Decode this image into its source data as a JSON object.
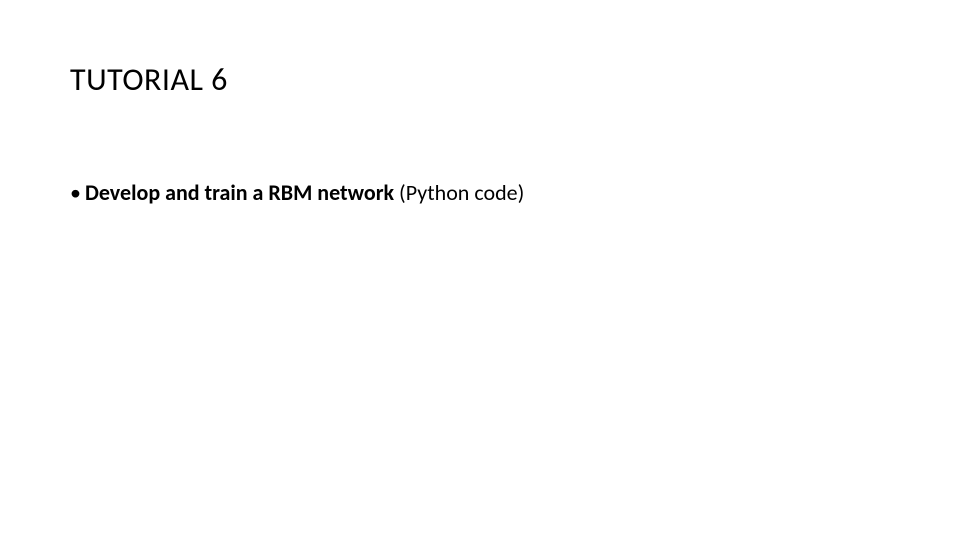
{
  "slide": {
    "title": "TUTORIAL 6",
    "bullet": {
      "mark": "•",
      "bold_part": "Develop and train a RBM network",
      "rest_part": " (Python code)"
    }
  }
}
